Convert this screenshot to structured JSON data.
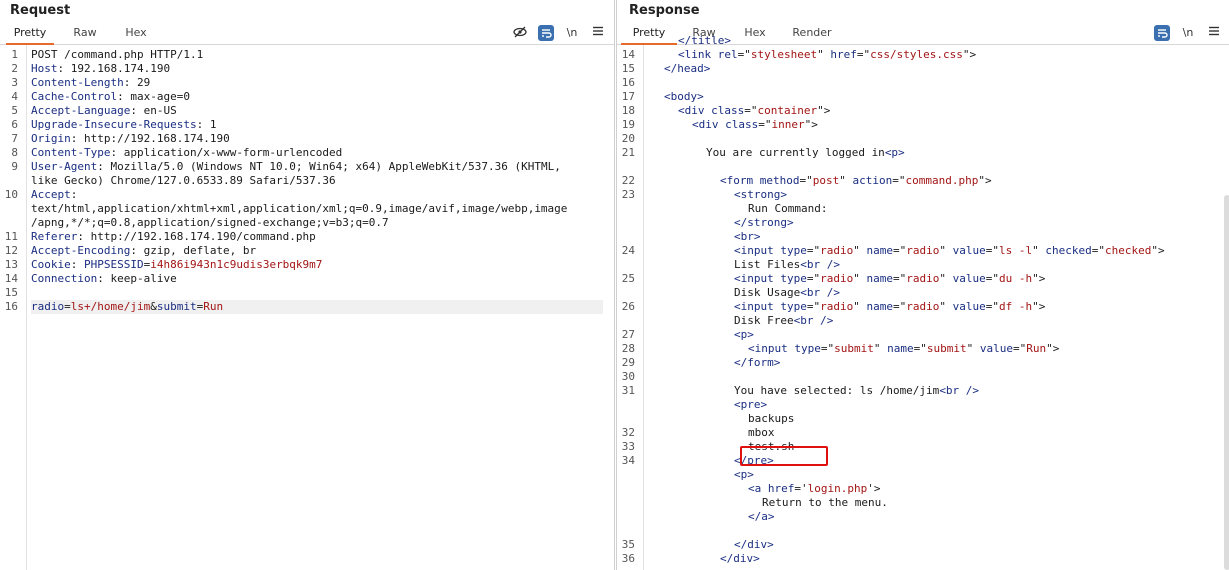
{
  "request": {
    "title": "Request",
    "tabs": [
      "Pretty",
      "Raw",
      "Hex"
    ],
    "icons": [
      "eye-off-icon",
      "wrap-icon",
      "newline-icon",
      "menu-icon"
    ],
    "newline_label": "\\n",
    "line_numbers": [
      "1",
      "2",
      "3",
      "4",
      "5",
      "6",
      "7",
      "8",
      "9",
      "10",
      "11",
      "12",
      "13",
      "14",
      "15",
      "16"
    ],
    "lines": [
      {
        "segments": [
          {
            "t": "POST /command.php HTTP/1.1",
            "c": ""
          }
        ]
      },
      {
        "segments": [
          {
            "t": "Host",
            "c": "k"
          },
          {
            "t": ": 192.168.174.190",
            "c": ""
          }
        ]
      },
      {
        "segments": [
          {
            "t": "Content-Length",
            "c": "k"
          },
          {
            "t": ": 29",
            "c": ""
          }
        ]
      },
      {
        "segments": [
          {
            "t": "Cache-Control",
            "c": "k"
          },
          {
            "t": ": max-age=0",
            "c": ""
          }
        ]
      },
      {
        "segments": [
          {
            "t": "Accept-Language",
            "c": "k"
          },
          {
            "t": ": en-US",
            "c": ""
          }
        ]
      },
      {
        "segments": [
          {
            "t": "Upgrade-Insecure-Requests",
            "c": "k"
          },
          {
            "t": ": 1",
            "c": ""
          }
        ]
      },
      {
        "segments": [
          {
            "t": "Origin",
            "c": "k"
          },
          {
            "t": ": http://192.168.174.190",
            "c": ""
          }
        ]
      },
      {
        "segments": [
          {
            "t": "Content-Type",
            "c": "k"
          },
          {
            "t": ": application/x-www-form-urlencoded",
            "c": ""
          }
        ]
      },
      {
        "segments": [
          {
            "t": "User-Agent",
            "c": "k"
          },
          {
            "t": ": Mozilla/5.0 (Windows NT 10.0; Win64; x64) AppleWebKit/537.36 (KHTML,",
            "c": ""
          }
        ]
      },
      {
        "segments": [
          {
            "t": "like Gecko) Chrome/127.0.6533.89 Safari/537.36",
            "c": ""
          }
        ]
      },
      {
        "segments": [
          {
            "t": "Accept",
            "c": "k"
          },
          {
            "t": ":",
            "c": ""
          }
        ]
      },
      {
        "segments": [
          {
            "t": "text/html,application/xhtml+xml,application/xml;q=0.9,image/avif,image/webp,image",
            "c": ""
          }
        ]
      },
      {
        "segments": [
          {
            "t": "/apng,*/*;q=0.8,application/signed-exchange;v=b3;q=0.7",
            "c": ""
          }
        ]
      },
      {
        "segments": [
          {
            "t": "Referer",
            "c": "k"
          },
          {
            "t": ": http://192.168.174.190/command.php",
            "c": ""
          }
        ]
      },
      {
        "segments": [
          {
            "t": "Accept-Encoding",
            "c": "k"
          },
          {
            "t": ": gzip, deflate, br",
            "c": ""
          }
        ]
      },
      {
        "segments": [
          {
            "t": "Cookie",
            "c": "k"
          },
          {
            "t": ": ",
            "c": ""
          },
          {
            "t": "PHPSESSID",
            "c": "k"
          },
          {
            "t": "=",
            "c": ""
          },
          {
            "t": "i4h86i943n1c9udis3erbqk9m7",
            "c": "v"
          }
        ]
      },
      {
        "segments": [
          {
            "t": "Connection",
            "c": "k"
          },
          {
            "t": ": keep-alive",
            "c": ""
          }
        ]
      },
      {
        "segments": [
          {
            "t": "",
            "c": ""
          }
        ]
      },
      {
        "segments": [
          {
            "t": "radio",
            "c": "k"
          },
          {
            "t": "=",
            "c": ""
          },
          {
            "t": "ls+/home/jim",
            "c": "v"
          },
          {
            "t": "&",
            "c": ""
          },
          {
            "t": "submit",
            "c": "k"
          },
          {
            "t": "=",
            "c": ""
          },
          {
            "t": "Run",
            "c": "v"
          }
        ]
      }
    ]
  },
  "response": {
    "title": "Response",
    "tabs": [
      "Pretty",
      "Raw",
      "Hex",
      "Render"
    ],
    "icons": [
      "wrap-icon",
      "newline-icon",
      "menu-icon"
    ],
    "newline_label": "\\n",
    "line_numbers": [
      {
        "n": "14",
        "row": 1
      },
      {
        "n": "15",
        "row": 2
      },
      {
        "n": "16",
        "row": 3
      },
      {
        "n": "17",
        "row": 4
      },
      {
        "n": "18",
        "row": 5
      },
      {
        "n": "19",
        "row": 6
      },
      {
        "n": "20",
        "row": 7
      },
      {
        "n": "21",
        "row": 8
      },
      {
        "n": "22",
        "row": 10
      },
      {
        "n": "23",
        "row": 11
      },
      {
        "n": "24",
        "row": 15
      },
      {
        "n": "25",
        "row": 17
      },
      {
        "n": "26",
        "row": 19
      },
      {
        "n": "27",
        "row": 21
      },
      {
        "n": "28",
        "row": 22
      },
      {
        "n": "29",
        "row": 23
      },
      {
        "n": "30",
        "row": 24
      },
      {
        "n": "31",
        "row": 25
      },
      {
        "n": "32",
        "row": 28
      },
      {
        "n": "33",
        "row": 29
      },
      {
        "n": "34",
        "row": 30
      },
      {
        "n": "35",
        "row": 36
      },
      {
        "n": "36",
        "row": 37
      }
    ],
    "lines": [
      {
        "indent": 1,
        "segments": [
          {
            "t": "</title>",
            "c": "t"
          }
        ]
      },
      {
        "indent": 1,
        "segments": [
          {
            "t": "<link ",
            "c": "t"
          },
          {
            "t": "rel",
            "c": "a"
          },
          {
            "t": "=\"",
            "c": ""
          },
          {
            "t": "stylesheet",
            "c": "v"
          },
          {
            "t": "\" ",
            "c": ""
          },
          {
            "t": "href",
            "c": "a"
          },
          {
            "t": "=\"",
            "c": ""
          },
          {
            "t": "css/styles.css",
            "c": "v"
          },
          {
            "t": "\">",
            "c": ""
          }
        ]
      },
      {
        "indent": 0,
        "segments": [
          {
            "t": "</head>",
            "c": "t"
          }
        ]
      },
      {
        "indent": 0,
        "segments": [
          {
            "t": "",
            "c": ""
          }
        ]
      },
      {
        "indent": 0,
        "segments": [
          {
            "t": "<body>",
            "c": "t"
          }
        ]
      },
      {
        "indent": 1,
        "segments": [
          {
            "t": "<div ",
            "c": "t"
          },
          {
            "t": "class",
            "c": "a"
          },
          {
            "t": "=\"",
            "c": ""
          },
          {
            "t": "container",
            "c": "v"
          },
          {
            "t": "\">",
            "c": ""
          }
        ]
      },
      {
        "indent": 2,
        "segments": [
          {
            "t": "<div ",
            "c": "t"
          },
          {
            "t": "class",
            "c": "a"
          },
          {
            "t": "=\"",
            "c": ""
          },
          {
            "t": "inner",
            "c": "v"
          },
          {
            "t": "\">",
            "c": ""
          }
        ]
      },
      {
        "indent": 0,
        "segments": [
          {
            "t": "",
            "c": ""
          }
        ]
      },
      {
        "indent": 3,
        "segments": [
          {
            "t": "You are currently logged in",
            "c": ""
          },
          {
            "t": "<p>",
            "c": "t"
          }
        ]
      },
      {
        "indent": 0,
        "segments": [
          {
            "t": "",
            "c": ""
          }
        ]
      },
      {
        "indent": 4,
        "segments": [
          {
            "t": "<form ",
            "c": "t"
          },
          {
            "t": "method",
            "c": "a"
          },
          {
            "t": "=\"",
            "c": ""
          },
          {
            "t": "post",
            "c": "v"
          },
          {
            "t": "\" ",
            "c": ""
          },
          {
            "t": "action",
            "c": "a"
          },
          {
            "t": "=\"",
            "c": ""
          },
          {
            "t": "command.php",
            "c": "v"
          },
          {
            "t": "\">",
            "c": ""
          }
        ]
      },
      {
        "indent": 5,
        "segments": [
          {
            "t": "<strong>",
            "c": "t"
          }
        ]
      },
      {
        "indent": 6,
        "segments": [
          {
            "t": "Run Command:",
            "c": ""
          }
        ]
      },
      {
        "indent": 5,
        "segments": [
          {
            "t": "</strong>",
            "c": "t"
          }
        ]
      },
      {
        "indent": 5,
        "segments": [
          {
            "t": "<br>",
            "c": "t"
          }
        ]
      },
      {
        "indent": 5,
        "segments": [
          {
            "t": "<input ",
            "c": "t"
          },
          {
            "t": "type",
            "c": "a"
          },
          {
            "t": "=\"",
            "c": ""
          },
          {
            "t": "radio",
            "c": "v"
          },
          {
            "t": "\" ",
            "c": ""
          },
          {
            "t": "name",
            "c": "a"
          },
          {
            "t": "=\"",
            "c": ""
          },
          {
            "t": "radio",
            "c": "v"
          },
          {
            "t": "\" ",
            "c": ""
          },
          {
            "t": "value",
            "c": "a"
          },
          {
            "t": "=\"",
            "c": ""
          },
          {
            "t": "ls -l",
            "c": "v"
          },
          {
            "t": "\" ",
            "c": ""
          },
          {
            "t": "checked",
            "c": "a"
          },
          {
            "t": "=\"",
            "c": ""
          },
          {
            "t": "checked",
            "c": "v"
          },
          {
            "t": "\">",
            "c": ""
          }
        ]
      },
      {
        "indent": 5,
        "segments": [
          {
            "t": "List Files",
            "c": ""
          },
          {
            "t": "<br />",
            "c": "t"
          }
        ]
      },
      {
        "indent": 5,
        "segments": [
          {
            "t": "<input ",
            "c": "t"
          },
          {
            "t": "type",
            "c": "a"
          },
          {
            "t": "=\"",
            "c": ""
          },
          {
            "t": "radio",
            "c": "v"
          },
          {
            "t": "\" ",
            "c": ""
          },
          {
            "t": "name",
            "c": "a"
          },
          {
            "t": "=\"",
            "c": ""
          },
          {
            "t": "radio",
            "c": "v"
          },
          {
            "t": "\" ",
            "c": ""
          },
          {
            "t": "value",
            "c": "a"
          },
          {
            "t": "=\"",
            "c": ""
          },
          {
            "t": "du -h",
            "c": "v"
          },
          {
            "t": "\">",
            "c": ""
          }
        ]
      },
      {
        "indent": 5,
        "segments": [
          {
            "t": "Disk Usage",
            "c": ""
          },
          {
            "t": "<br />",
            "c": "t"
          }
        ]
      },
      {
        "indent": 5,
        "segments": [
          {
            "t": "<input ",
            "c": "t"
          },
          {
            "t": "type",
            "c": "a"
          },
          {
            "t": "=\"",
            "c": ""
          },
          {
            "t": "radio",
            "c": "v"
          },
          {
            "t": "\" ",
            "c": ""
          },
          {
            "t": "name",
            "c": "a"
          },
          {
            "t": "=\"",
            "c": ""
          },
          {
            "t": "radio",
            "c": "v"
          },
          {
            "t": "\" ",
            "c": ""
          },
          {
            "t": "value",
            "c": "a"
          },
          {
            "t": "=\"",
            "c": ""
          },
          {
            "t": "df -h",
            "c": "v"
          },
          {
            "t": "\">",
            "c": ""
          }
        ]
      },
      {
        "indent": 5,
        "segments": [
          {
            "t": "Disk Free",
            "c": ""
          },
          {
            "t": "<br />",
            "c": "t"
          }
        ]
      },
      {
        "indent": 5,
        "segments": [
          {
            "t": "<p>",
            "c": "t"
          }
        ]
      },
      {
        "indent": 6,
        "segments": [
          {
            "t": "<input ",
            "c": "t"
          },
          {
            "t": "type",
            "c": "a"
          },
          {
            "t": "=\"",
            "c": ""
          },
          {
            "t": "submit",
            "c": "v"
          },
          {
            "t": "\" ",
            "c": ""
          },
          {
            "t": "name",
            "c": "a"
          },
          {
            "t": "=\"",
            "c": ""
          },
          {
            "t": "submit",
            "c": "v"
          },
          {
            "t": "\" ",
            "c": ""
          },
          {
            "t": "value",
            "c": "a"
          },
          {
            "t": "=\"",
            "c": ""
          },
          {
            "t": "Run",
            "c": "v"
          },
          {
            "t": "\">",
            "c": ""
          }
        ]
      },
      {
        "indent": 5,
        "segments": [
          {
            "t": "</form>",
            "c": "t"
          }
        ]
      },
      {
        "indent": 0,
        "segments": [
          {
            "t": "",
            "c": ""
          }
        ]
      },
      {
        "indent": 5,
        "segments": [
          {
            "t": "You have selected: ls /home/jim",
            "c": ""
          },
          {
            "t": "<br />",
            "c": "t"
          }
        ]
      },
      {
        "indent": 5,
        "segments": [
          {
            "t": "<pre>",
            "c": "t"
          }
        ]
      },
      {
        "indent": 6,
        "segments": [
          {
            "t": "backups",
            "c": ""
          }
        ]
      },
      {
        "indent": 6,
        "segments": [
          {
            "t": "mbox",
            "c": ""
          }
        ]
      },
      {
        "indent": 6,
        "segments": [
          {
            "t": "test.sh",
            "c": ""
          }
        ]
      },
      {
        "indent": 5,
        "segments": [
          {
            "t": "</pre>",
            "c": "t"
          }
        ]
      },
      {
        "indent": 5,
        "segments": [
          {
            "t": "<p>",
            "c": "t"
          }
        ]
      },
      {
        "indent": 6,
        "segments": [
          {
            "t": "<a ",
            "c": "t"
          },
          {
            "t": "href",
            "c": "a"
          },
          {
            "t": "='",
            "c": ""
          },
          {
            "t": "login.php",
            "c": "v"
          },
          {
            "t": "'>",
            "c": ""
          }
        ]
      },
      {
        "indent": 7,
        "segments": [
          {
            "t": "Return to the menu.",
            "c": ""
          }
        ]
      },
      {
        "indent": 6,
        "segments": [
          {
            "t": "</a>",
            "c": "t"
          }
        ]
      },
      {
        "indent": 0,
        "segments": [
          {
            "t": "",
            "c": ""
          }
        ]
      },
      {
        "indent": 5,
        "segments": [
          {
            "t": "</div>",
            "c": "t"
          }
        ]
      },
      {
        "indent": 4,
        "segments": [
          {
            "t": "</div>",
            "c": "t"
          }
        ]
      }
    ]
  },
  "colors": {
    "accent_tab": "#e8692c",
    "header_key": "#1b2e82",
    "value": "#a31515",
    "highlight_box": "#e01010"
  }
}
